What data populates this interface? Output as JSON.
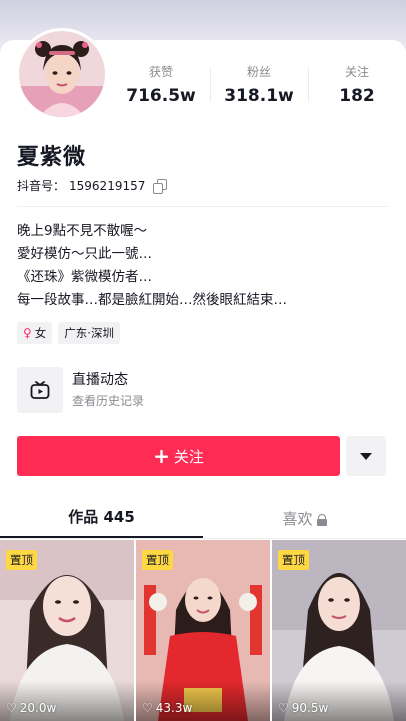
{
  "profile": {
    "name": "夏紫微",
    "id_label": "抖音号：",
    "id_value": "1596219157"
  },
  "stats": [
    {
      "label": "获赞",
      "value": "716.5w"
    },
    {
      "label": "粉丝",
      "value": "318.1w"
    },
    {
      "label": "关注",
      "value": "182"
    }
  ],
  "bio": [
    "晚上9點不見不散喔～",
    "愛好模仿～只此一號…",
    "《还珠》紫微模仿者…",
    "每一段故事…都是臉紅開始…然後眼紅結束…"
  ],
  "tags": {
    "gender_icon": "♀",
    "gender": "女",
    "location": "广东·深圳"
  },
  "live": {
    "title": "直播动态",
    "subtitle": "查看历史记录"
  },
  "actions": {
    "follow_plus": "+",
    "follow_label": "关注"
  },
  "tabs": {
    "works_label": "作品 445",
    "likes_label": "喜欢"
  },
  "videos": [
    {
      "pin": "置顶",
      "likes": "20.0w"
    },
    {
      "pin": "置顶",
      "likes": "43.3w"
    },
    {
      "pin": "置顶",
      "likes": "90.5w"
    }
  ],
  "colors": {
    "accent": "#fe2c55",
    "pin": "#fdd843",
    "muted": "#8a8b91"
  }
}
